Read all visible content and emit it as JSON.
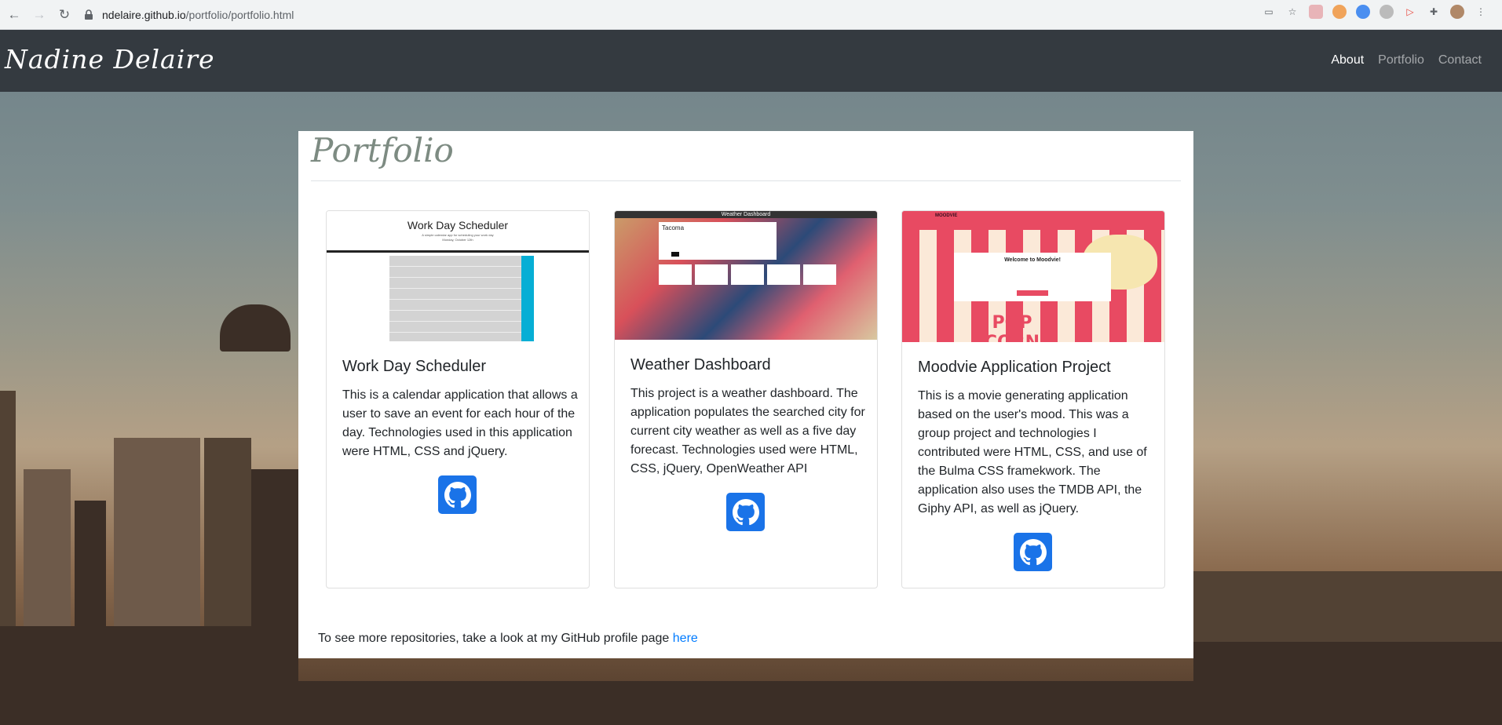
{
  "browser": {
    "url_host": "ndelaire.github.io",
    "url_path": "/portfolio/portfolio.html"
  },
  "navbar": {
    "brand": "Nadine Delaire",
    "links": [
      {
        "label": "About",
        "active": true
      },
      {
        "label": "Portfolio",
        "active": false
      },
      {
        "label": "Contact",
        "active": false
      }
    ]
  },
  "page": {
    "title": "Portfolio",
    "footer_text": "To see more repositories, take a look at my GitHub profile page ",
    "footer_link": "here"
  },
  "cards": [
    {
      "title": "Work Day Scheduler",
      "text": "This is a calendar application that allows a user to save an event for each hour of the day. Technologies used in this application were HTML, CSS and jQuery.",
      "thumb_title": "Work Day Scheduler",
      "thumb_subtitle": "A simple calendar app for scheduling your work day",
      "thumb_date": "Monday, October 12th"
    },
    {
      "title": "Weather Dashboard",
      "text": "This project is a weather dashboard. The application populates the searched city for current city weather as well as a five day forecast. Technologies used were HTML, CSS, jQuery, OpenWeather API",
      "thumb_title": "Weather Dashboard",
      "thumb_city": "Tacoma"
    },
    {
      "title": "Moodvie Application Project",
      "text": "This is a movie generating application based on the user's mood. This was a group project and technologies I contributed were HTML, CSS, and use of the Bulma CSS framekwork. The application also uses the TMDB API, the Giphy API, as well as jQuery.",
      "thumb_brand": "MOODVIE",
      "thumb_heading": "Welcome to Moodvie!",
      "thumb_sign": "POP CORN"
    }
  ],
  "colors": {
    "navbar_bg": "#343a40",
    "link_blue": "#007bff",
    "github_blue": "#1a73e8"
  }
}
